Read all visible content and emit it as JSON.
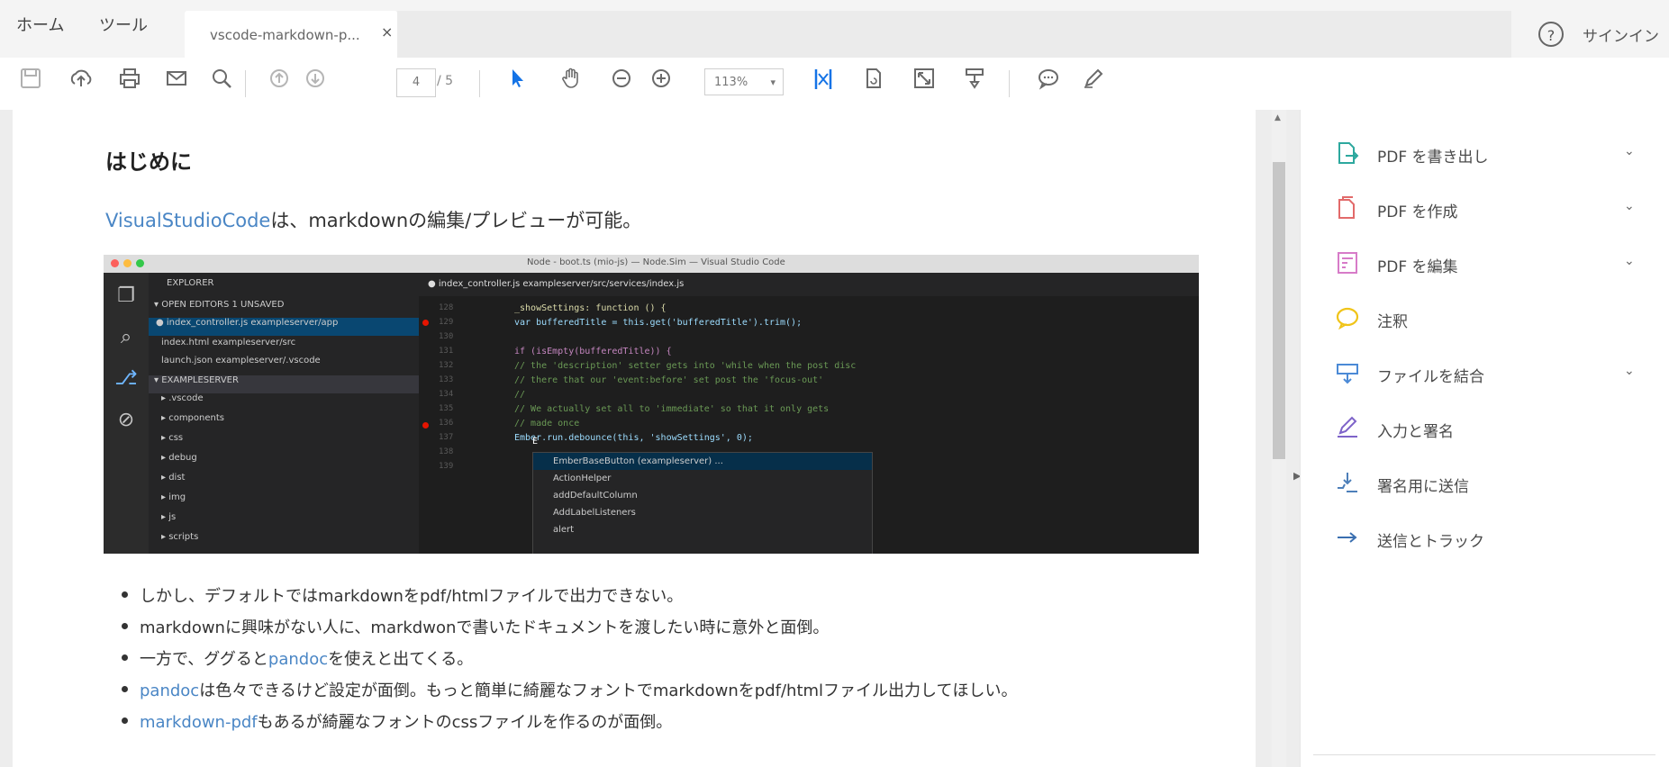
{
  "tabs": {
    "home": "ホーム",
    "tools": "ツール",
    "document": "vscode-markdown-p...",
    "close": "×"
  },
  "header": {
    "help": "?",
    "signin": "サインイン"
  },
  "toolbar": {
    "page_current": "4",
    "page_total": "/ 5",
    "zoom": "113%",
    "zoom_caret": "▾"
  },
  "document": {
    "heading": "はじめに",
    "intro_link": "VisualStudioCode",
    "intro_rest": "は、markdownの編集/プレビューが可能。",
    "bullets": [
      {
        "pre": "しかし、デフォルトではmarkdownをpdf/htmlファイルで出力できない。",
        "link": "",
        "post": ""
      },
      {
        "pre": "markdownに興味がない人に、markdwonで書いたドキュメントを渡したい時に意外と面倒。",
        "link": "",
        "post": ""
      },
      {
        "pre": "一方で、ググると",
        "link": "pandoc",
        "post": "を使えと出てくる。"
      },
      {
        "pre": "",
        "link": "pandoc",
        "post": "は色々できるけど設定が面倒。もっと簡単に綺麗なフォントでmarkdownをpdf/htmlファイル出力してほしい。"
      },
      {
        "pre": "",
        "link": "markdown-pdf",
        "post": "もあるが綺麗なフォントのcssファイルを作るのが面倒。"
      }
    ],
    "screenshot": {
      "window_title": "Node - boot.ts (mio-js) — Node.Sim — Visual Studio Code",
      "explorer_rows": [
        "EXPLORER",
        "▾ OPEN EDITORS   1 UNSAVED",
        "● index_controller.js  exampleserver/app",
        "   index.html  exampleserver/src",
        "   launch.json  exampleserver/.vscode",
        "▾ EXAMPLESERVER",
        "   ▸ .vscode",
        "   ▸ components",
        "   ▸ css",
        "   ▸ debug",
        "   ▸ dist",
        "   ▸ img",
        "   ▸ js",
        "   ▸ scripts"
      ],
      "editor_tab": "● index_controller.js   exampleserver/src/services/index.js",
      "code_lines": [
        "_showSettings: function () {",
        "  var bufferedTitle = this.get('bufferedTitle').trim();",
        "",
        "  if (isEmpty(bufferedTitle)) {",
        "    // the 'description' setter gets into 'while when the post disc",
        "    // there that our 'event:before' set post the 'focus-out'",
        "    //",
        "    // We actually set all to 'immediate' so that it only gets",
        "    // made once",
        "    Ember.run.debounce(this, 'showSettings', 0);",
        "",
        "  E"
      ],
      "suggestions": [
        "EmberBaseButton  (exampleserver) ...",
        "ActionHelper",
        "addDefaultColumn",
        "AddLabelListeners",
        "alert"
      ]
    }
  },
  "right_panel": [
    {
      "label": "PDF を書き出し",
      "icon": "export-pdf-icon",
      "color": "#2da89e",
      "chevron": true
    },
    {
      "label": "PDF を作成",
      "icon": "create-pdf-icon",
      "color": "#e26a6a",
      "chevron": true
    },
    {
      "label": "PDF を編集",
      "icon": "edit-pdf-icon",
      "color": "#d77bc8",
      "chevron": true
    },
    {
      "label": "注釈",
      "icon": "comment-icon",
      "color": "#f0c419",
      "chevron": false
    },
    {
      "label": "ファイルを結合",
      "icon": "combine-files-icon",
      "color": "#4b8ad6",
      "chevron": true
    },
    {
      "label": "入力と署名",
      "icon": "fill-sign-icon",
      "color": "#7e63c9",
      "chevron": false
    },
    {
      "label": "署名用に送信",
      "icon": "send-for-signature-icon",
      "color": "#4d7fb9",
      "chevron": false
    },
    {
      "label": "送信とトラック",
      "icon": "send-and-track-icon",
      "color": "#3a6fb0",
      "chevron": false
    }
  ],
  "glyphs": {
    "chevron": "⌄",
    "bp_marker": "●"
  },
  "colors": {
    "accent": "#1473e6",
    "link": "#4a86c5"
  }
}
